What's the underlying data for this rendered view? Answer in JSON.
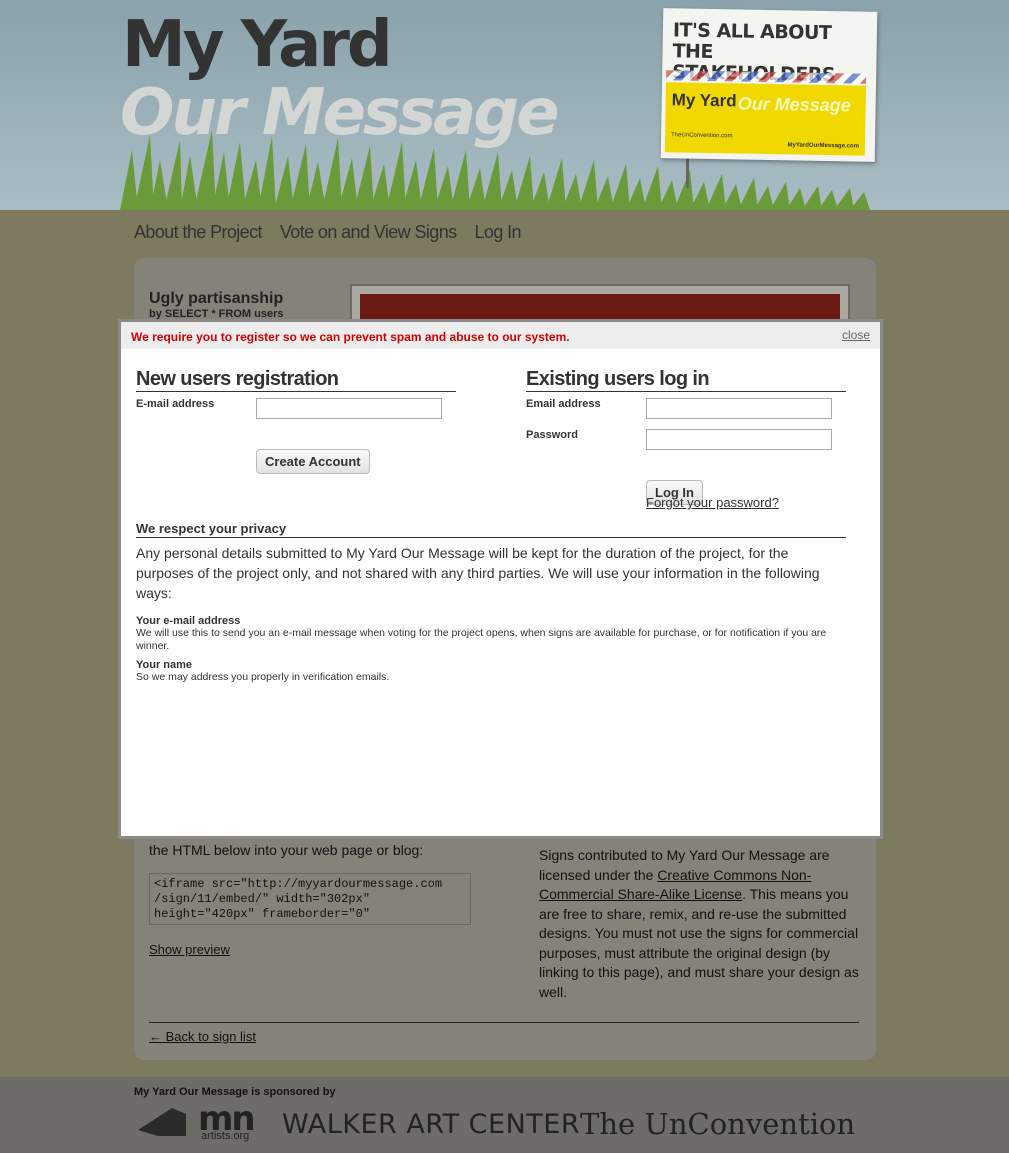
{
  "header": {
    "logo_line1": "My Yard",
    "logo_line2": "Our Message",
    "sign": {
      "top_text_line1": "IT'S ALL ABOUT",
      "top_text_line2": "THE STAKEHOLDERS",
      "brand_my": "My Yard",
      "brand_our": "Our Message",
      "url_left": "TheUnConvention.com",
      "url_right": "MyYardOurMessage.com"
    }
  },
  "nav": {
    "items": [
      {
        "label": "About the Project"
      },
      {
        "label": "Vote on and View Signs"
      },
      {
        "label": "Log In"
      }
    ]
  },
  "sign_page": {
    "title": "Ugly partisanship",
    "byline": "by SELECT * FROM users",
    "embed_text": "the HTML below into your web page or blog:",
    "embed_code": "<iframe src=\"http://myyardourmessage.com\n/sign/11/embed/\" width=\"302px\"\nheight=\"420px\" frameborder=\"0\"",
    "show_preview": "Show preview",
    "license_before": "Signs contributed to My Yard Our Message are licensed under the ",
    "license_link": "Creative Commons Non-Commercial Share-Alike License",
    "license_after": ". This means you are free to share, remix, and re-use the submitted designs. You must not use the signs for commercial purposes, must attribute the original design (by linking to this page), and must share your design as well.",
    "back_link": "← Back to sign list"
  },
  "footer": {
    "sponsored": "My Yard Our Message is sponsored by",
    "mn": "mn",
    "artists": "artists.org",
    "walker": "WALKER ART CENTER",
    "unconvention": "The UnConvention"
  },
  "modal": {
    "message": "We require you to register so we can prevent spam and abuse to our system.",
    "close": "close",
    "registration": {
      "title": "New users registration",
      "email_label": "E-mail address",
      "email_value": "",
      "button": "Create Account"
    },
    "login": {
      "title": "Existing users log in",
      "email_label": "Email address",
      "email_value": "",
      "password_label": "Password",
      "password_value": "",
      "button": "Log In",
      "forgot": "Forgot your password?"
    },
    "privacy": {
      "title": "We respect your privacy",
      "body": "Any personal details submitted to My Yard Our Message will be kept for the duration of the project, for the purposes of the project only, and not shared with any third parties. We will use your information in the following ways:",
      "items": [
        {
          "title": "Your e-mail address",
          "text": "We will use this to send you an e-mail message when voting for the project opens, when signs are available for purchase, or for notification if you are winner."
        },
        {
          "title": "Your name",
          "text": "So we may address you properly in verification emails."
        }
      ]
    }
  },
  "colors": {
    "error_text": "#d40000",
    "sky": "#a9bcc3",
    "sign_yellow": "#f0d800",
    "panel_dimmed": "#858379"
  }
}
